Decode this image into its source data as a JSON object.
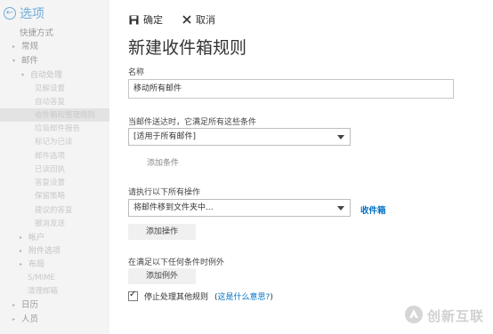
{
  "sidebar": {
    "back_label": "选项",
    "items": [
      {
        "label": "快捷方式",
        "level": "top"
      },
      {
        "label": "常规",
        "level": "top"
      },
      {
        "label": "邮件",
        "level": "top"
      },
      {
        "label": "自动处理",
        "level": "l2"
      },
      {
        "label": "见解设置",
        "level": "l3"
      },
      {
        "label": "自动答复",
        "level": "l3"
      },
      {
        "label": "收件箱和整理规则",
        "level": "l3"
      },
      {
        "label": "垃圾邮件报告",
        "level": "l3"
      },
      {
        "label": "标记为已读",
        "level": "l3"
      },
      {
        "label": "邮件选项",
        "level": "l3"
      },
      {
        "label": "已读回执",
        "level": "l3"
      },
      {
        "label": "答复设置",
        "level": "l3"
      },
      {
        "label": "保留策略",
        "level": "l3"
      },
      {
        "label": "建议的答复",
        "level": "l3"
      },
      {
        "label": "撤消发送",
        "level": "l3"
      },
      {
        "label": "帐户",
        "level": "l2"
      },
      {
        "label": "附件选项",
        "level": "l2"
      },
      {
        "label": "布局",
        "level": "l2"
      },
      {
        "label": "S/MIME",
        "level": "l3"
      },
      {
        "label": "清理邮箱",
        "level": "l3"
      },
      {
        "label": "日历",
        "level": "top"
      },
      {
        "label": "人员",
        "level": "top"
      }
    ]
  },
  "toolbar": {
    "save_label": "确定",
    "cancel_label": "取消"
  },
  "form": {
    "title": "新建收件箱规则",
    "name_label": "名称",
    "name_value": "移动所有邮件",
    "condition_label": "当邮件送达时，它满足所有这些条件",
    "condition_value": "[适用于所有邮件]",
    "add_condition_label": "添加条件",
    "action_label": "请执行以下所有操作",
    "action_value": "将邮件移到文件夹中...",
    "action_target": "收件箱",
    "add_action_label": "添加操作",
    "exception_label": "在满足以下任何条件时例外",
    "add_exception_label": "添加例外",
    "stop_rules_label": "停止处理其他规则",
    "stop_rules_checked": true,
    "help_open": "(",
    "help_link": "这是什么意思?",
    "help_close": ")"
  },
  "watermark": {
    "text": "创新互联"
  },
  "colors": {
    "accent": "#0072c6",
    "sidebar_bg": "#f4f4f4",
    "button_bg": "#f0f0f0"
  }
}
